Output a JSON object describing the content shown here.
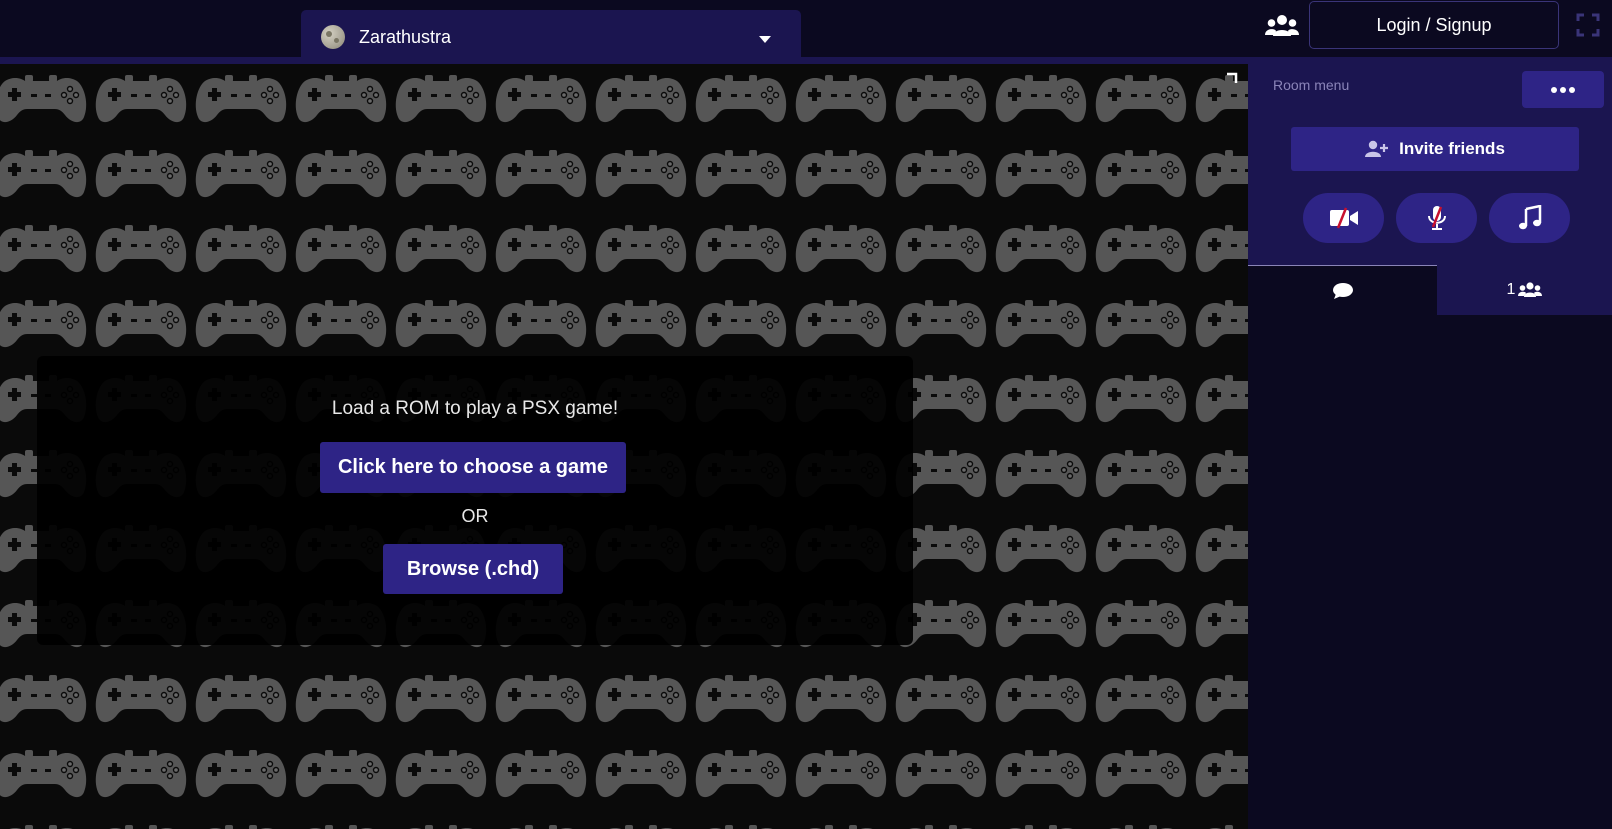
{
  "header": {
    "room_name": "Zarathustra",
    "login_label": "Login / Signup",
    "icons": [
      "planet-icon",
      "chevron-down-icon",
      "users-icon",
      "fullscreen-icon"
    ]
  },
  "game": {
    "load_title": "Load a ROM to play a PSX game!",
    "choose_button": "Click here to choose a game",
    "or_label": "OR",
    "browse_button": "Browse (.chd)",
    "background_icon": "gamepad-icon"
  },
  "sidebar": {
    "room_menu_label": "Room menu",
    "invite_label": "Invite friends",
    "media_buttons": [
      "video-off-icon",
      "mic-off-icon",
      "music-icon"
    ],
    "tabs": [
      {
        "icon": "chat-icon"
      },
      {
        "count": "1",
        "icon": "users-icon"
      }
    ]
  },
  "colors": {
    "background": "#0b0920",
    "panel": "#1b1550",
    "accent": "#2e2486",
    "muted_text": "#8a84b8",
    "disabled": "#c8102e"
  }
}
